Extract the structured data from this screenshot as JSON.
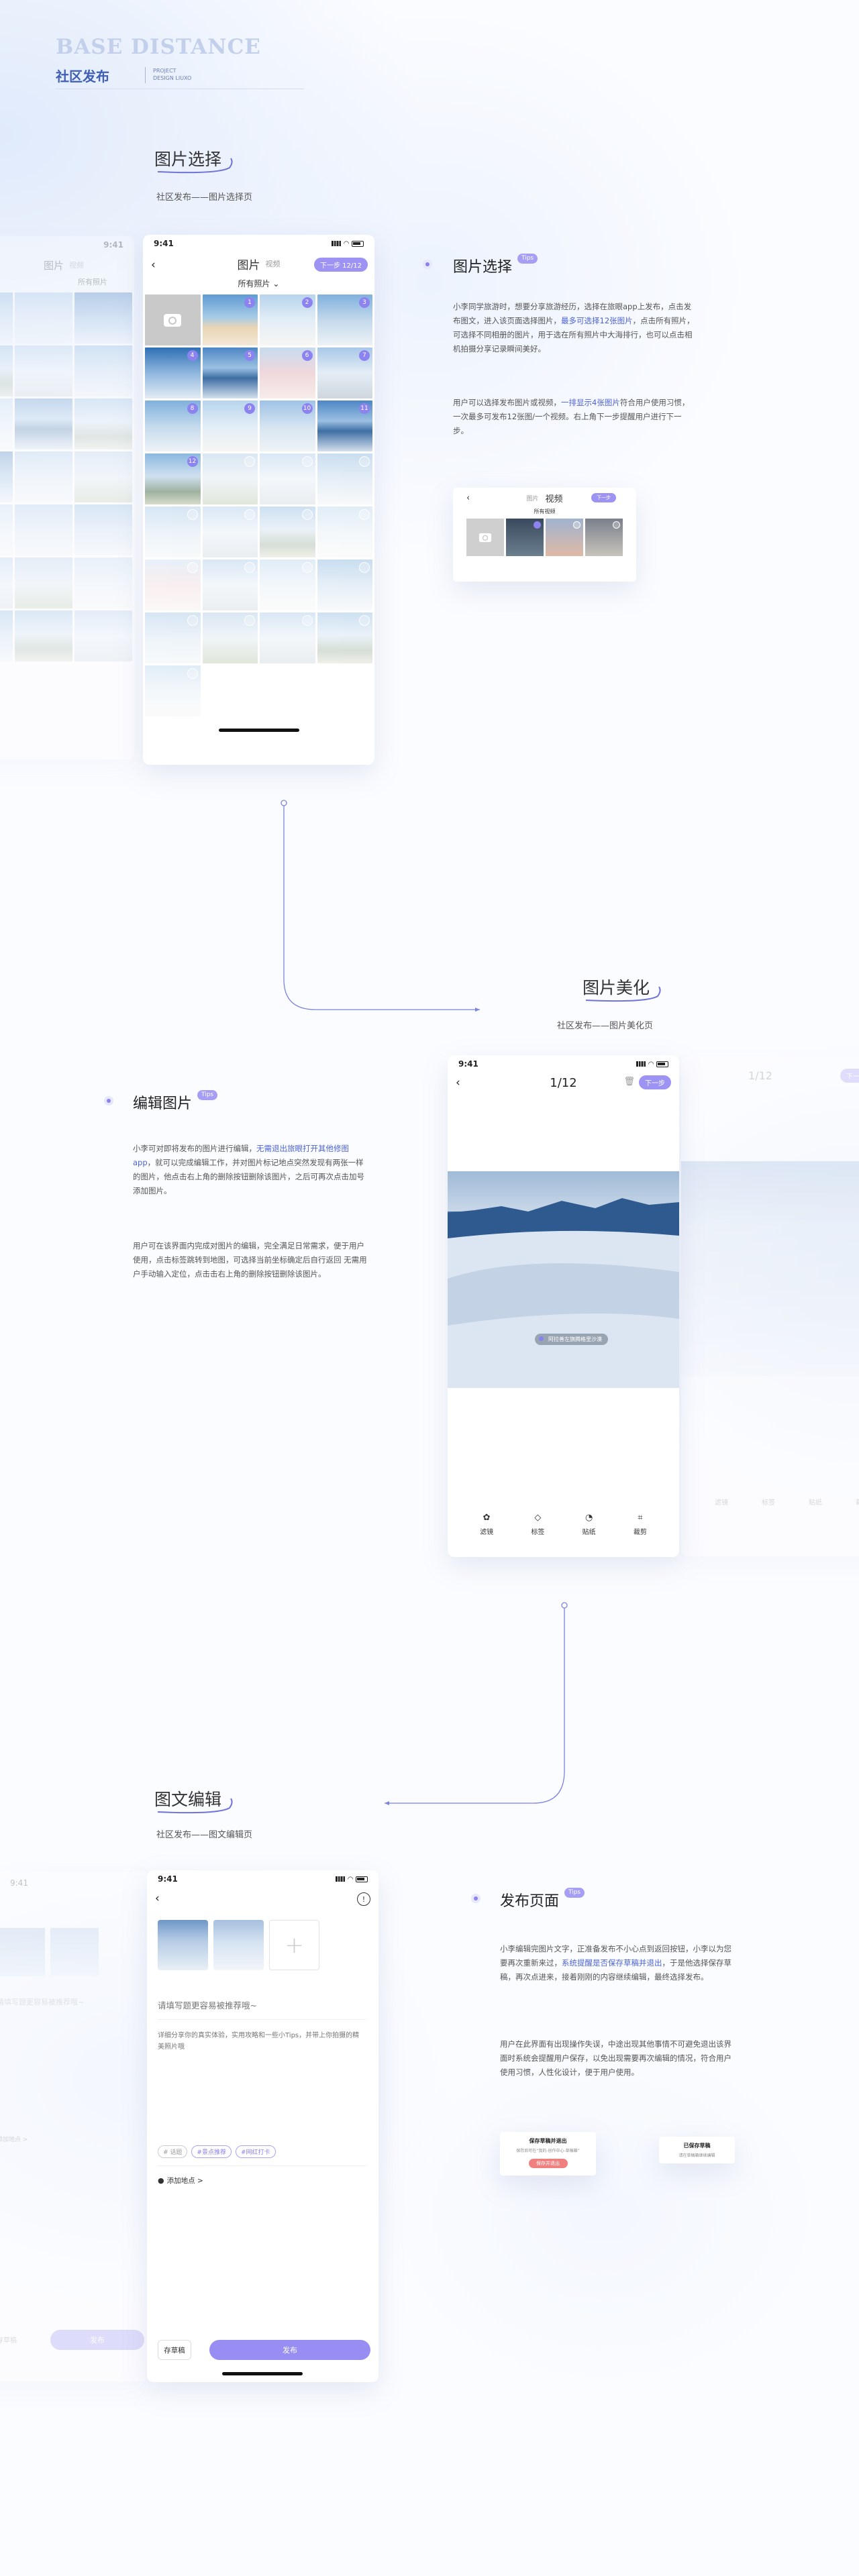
{
  "header": {
    "brand": "BASE DISTANCE",
    "subtitle": "社区发布",
    "project_line1": "PROJECT",
    "project_line2": "DESIGN LIUXO"
  },
  "colors": {
    "accent": "#978df2",
    "link": "#4d63d6",
    "brand_light": "#c3d0ec",
    "brand_dark": "#3f5fb5"
  },
  "sections": {
    "pick": {
      "title": "图片选择",
      "subtitle": "社区发布——图片选择页"
    },
    "beautify": {
      "title": "图片美化",
      "subtitle": "社区发布——图片美化页"
    },
    "compose": {
      "title": "图文编辑",
      "subtitle": "社区发布——图文编辑页"
    }
  },
  "blocks": {
    "pick": {
      "title": "图片选择",
      "tip": "Tips",
      "p1a": "小李同学旅游时，想要分享旅游经历，选择在旅眼app上发布，点击发布图文，进入该页面选择图片，",
      "p1hl": "最多可选择12张图片",
      "p1b": "，点击所有照片，可选择不同相册的图片，用于选在所有照片中大海排行，也可以点击相机拍摄分享记录瞬间美好。",
      "p2a": "用户可以选择发布图片或视频，",
      "p2hl": "一排显示4张图片",
      "p2b": "符合用户使用习惯，一次最多可发布12张图/一个视频。右上角下一步提醒用户进行下一步。"
    },
    "edit": {
      "title": "编辑图片",
      "tip": "Tips",
      "p1a": "小李可对即将发布的图片进行编辑，",
      "p1hl": "无需退出旅眼打开其他修图app",
      "p1b": "，就可以完成编辑工作，并对图片标记地点突然发现有两张一样的图片，他点击右上角的删除按钮删除该图片，之后可再次点击加号添加图片。",
      "p2": "用户可在该界面内完成对图片的编辑，完全满足日常需求，便于用户使用，点击标签跳转到地图，可选择当前坐标确定后自行返回 无需用户手动输入定位，点击击右上角的删除按钮删除该图片。"
    },
    "publish": {
      "title": "发布页面",
      "tip": "Tips",
      "p1a": "小李编辑完图片文字，正准备发布不小心点到返回按钮，小李以为您要再次重新来过，",
      "p1hl": "系统提醒是否保存草稿并退出",
      "p1b": "，于是他选择保存草稿，再次点进来，接着刚刚的内容继续编辑，最终选择发布。",
      "p2": "用户在此界面有出现操作失误，中途出现其他事情不可避免退出该界面时系统会提醒用户保存，以免出现需要再次编辑的情况，符合用户使用习惯，人性化设计，便于用户使用。"
    }
  },
  "phone_pick": {
    "time": "9:41",
    "tab_photo": "图片",
    "tab_video": "视频",
    "next": "下一步 12/12",
    "album": "所有照片",
    "badges": [
      "1",
      "2",
      "3",
      "4",
      "5",
      "6",
      "7",
      "8",
      "9",
      "10",
      "11",
      "12"
    ]
  },
  "mini_video": {
    "tab_photo": "图片",
    "tab_video": "视频",
    "next": "下一步",
    "album": "所有视频"
  },
  "phone_edit": {
    "time": "9:41",
    "counter": "1/12",
    "next": "下一步",
    "location": "阿拉善左旗腾格里沙漠",
    "tools": [
      "滤镜",
      "标签",
      "贴纸",
      "裁剪"
    ]
  },
  "phone_compose": {
    "time": "9:41",
    "title_placeholder": "请填写题更容易被推荐哦~",
    "body_placeholder": "详细分享你的真实体验，实用攻略和一些小Tips，并带上你拍摄的精美照片哦",
    "tags": [
      "# 话题",
      "#景点推荐",
      "#网红打卡"
    ],
    "location": "添加地点 >",
    "draft": "存草稿",
    "publish": "发布"
  },
  "dialogs": {
    "d1_title": "保存草稿并退出",
    "d1_text": "保存后可在“我的-创作中心-草稿箱”",
    "d1_btn": "保存并退出",
    "d2_title": "已保存草稿",
    "d2_text": "请在草稿箱继续编辑"
  },
  "ghost_left": {
    "time": "9:41",
    "tab_photo": "图片",
    "tab_video": "视频",
    "album": "所有照片"
  },
  "ghost_right": {
    "counter": "1/12",
    "next": "下一步",
    "tools": [
      "滤镜",
      "标签",
      "贴纸",
      "裁剪"
    ]
  },
  "ghost_compose": {
    "time": "9:41",
    "title_placeholder": "请填写题更容易被推荐哦~",
    "draft": "存草稿",
    "publish": "发布",
    "location": "添加地点 >"
  }
}
